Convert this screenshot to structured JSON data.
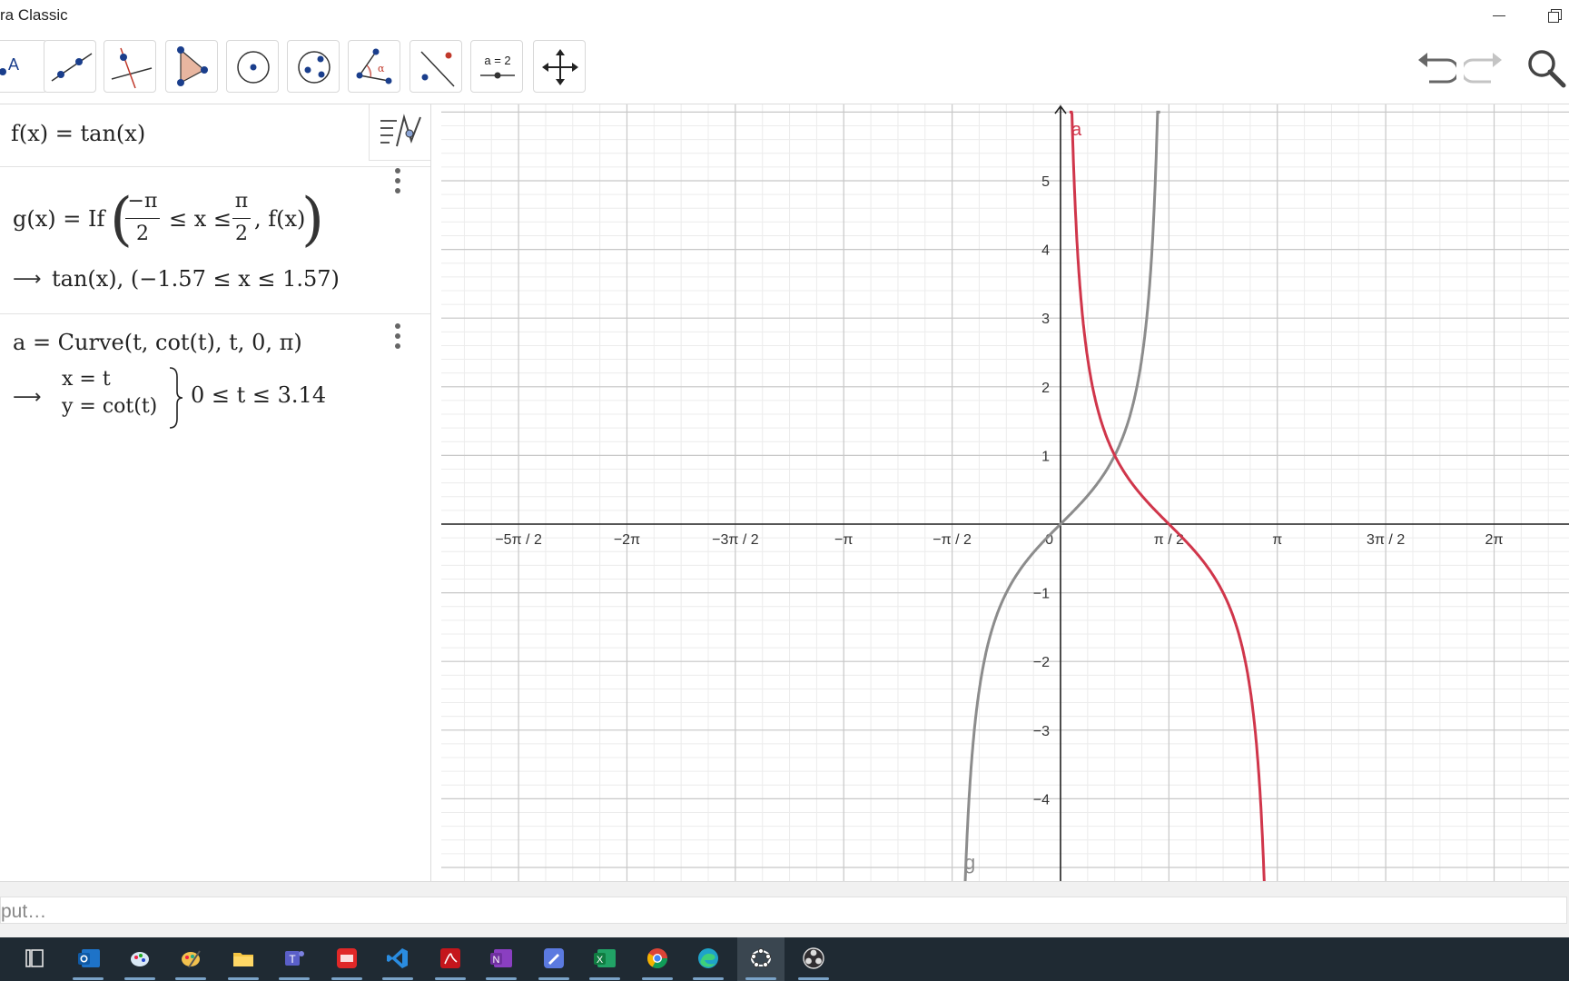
{
  "window": {
    "title": "ra Classic"
  },
  "toolbar": {
    "slider_label": "a = 2"
  },
  "algebra": {
    "rows": [
      {
        "definition": "f(x)  =  tan(x)"
      },
      {
        "definition_prefix": "g(x)  =  If",
        "definition_args": "≤ x ≤",
        "frac1_num": "−π",
        "frac1_den": "2",
        "frac2_num": "π",
        "frac2_den": "2",
        "definition_tail": ", f(x)",
        "result": "tan(x),     (−1.57 ≤ x ≤ 1.57)"
      },
      {
        "definition": "a  =  Curve(t, cot(t), t, 0, π)",
        "result_x": "x = t",
        "result_y": "y = cot(t)",
        "result_range": "0 ≤ t ≤ 3.14"
      }
    ]
  },
  "graphics": {
    "x_tick_labels": [
      "−5π / 2",
      "−2π",
      "−3π / 2",
      "−π",
      "−π / 2",
      "0",
      "π / 2",
      "π",
      "3π / 2",
      "2π"
    ],
    "y_tick_labels": [
      "5",
      "4",
      "3",
      "2",
      "1",
      "−1",
      "−2",
      "−3",
      "−4"
    ],
    "curve_labels": {
      "a": "a",
      "g": "g"
    },
    "colors": {
      "curve_a": "#d0364b",
      "curve_g": "#8c8c8c",
      "axis": "#222222",
      "grid_major": "#c8c8c8",
      "grid_minor": "#ececec"
    }
  },
  "input": {
    "placeholder": "put…"
  },
  "taskbar": {
    "icons": [
      "task-view-icon",
      "outlook-icon",
      "paint-icon",
      "paint-3d-icon",
      "file-explorer-icon",
      "teams-icon",
      "dictionary-icon",
      "vscode-icon",
      "acrobat-icon",
      "onenote-icon",
      "whiteboard-icon",
      "excel-icon",
      "chrome-icon",
      "edge-icon",
      "geogebra-icon",
      "obs-icon"
    ]
  }
}
